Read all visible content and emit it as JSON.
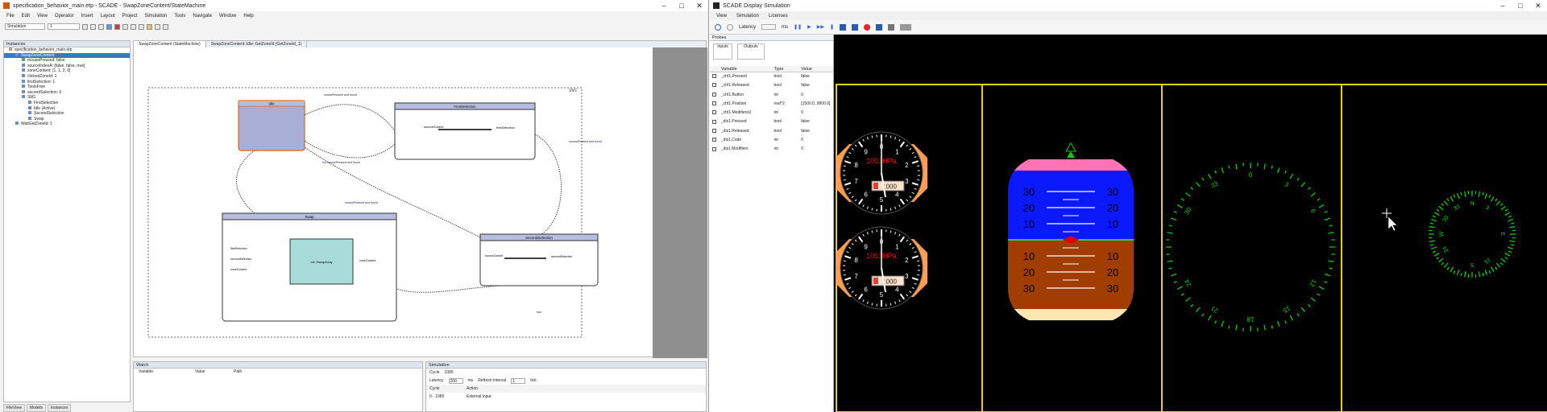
{
  "left_window": {
    "title": "specification_behavior_main.etp - SCADE - SwapZoneContent/StateMachine",
    "menu": [
      "File",
      "Edit",
      "View",
      "Operator",
      "Insert",
      "Layout",
      "Project",
      "Simulation",
      "Tools",
      "Navigate",
      "Window",
      "Help"
    ],
    "toolbar": {
      "config_combo": "Simulation",
      "config_combo2": "1"
    },
    "instances_panel": {
      "title": "Instances",
      "tree": [
        "specification_behavior_main.etp",
        "SwapZoneContent",
        "mousePressed: false",
        "sourceIndexA: [false, false, true]",
        "zoneContent: [1, 1, 2, 0]",
        "clickedZoneId: 1",
        "firstSelection: 1",
        "ToolsFree",
        "secondSelection: 0",
        "SM1",
        "FirstSelection",
        "Idle (Active)",
        "SecondSelection",
        "Swap",
        "WaitGetZoneId: 1"
      ]
    },
    "bottom_tabs": [
      "FileView",
      "Models",
      "Instances"
    ],
    "editor_tabs": [
      "SwapZoneContent (StateMachine)",
      "SwapZoneContent::Idle::GetZoneId (GetZoneId_1)"
    ],
    "diagram": {
      "states": [
        {
          "id": "idle",
          "label": "Idle"
        },
        {
          "id": "first",
          "label": "FirstSelection",
          "in": "sourceZoneId",
          "out": "firstSelection"
        },
        {
          "id": "swap",
          "label": "Swap",
          "inputs": [
            "firstSelection",
            "secondSelection",
            "zoneContent"
          ],
          "op": "Lib::SwapArray",
          "out": "zoneContent"
        },
        {
          "id": "second",
          "label": "SecondSelection",
          "in": "sourceZoneId",
          "out": "secondSelection"
        }
      ],
      "transitions": [
        "mousePressed and found",
        "not mousePressed and found",
        "mousePressed and found",
        "mousePressed and found",
        "true"
      ],
      "frame_label": "SM1"
    },
    "watch_panel": {
      "title": "Watch",
      "columns": [
        "Variable",
        "Value",
        "Path"
      ]
    },
    "simulation_panel": {
      "title": "Simulation",
      "cycle_label": "Cycle",
      "cycle_value": "1085",
      "latency_label": "Latency",
      "latency_value": "200",
      "latency_unit": "ms",
      "refresh_label": "Refresh interval",
      "refresh_value": "1",
      "refresh_unit": "tick",
      "cols": [
        "Cycle",
        "Action"
      ],
      "row": {
        "cycle": "0 - 1085",
        "action": "External input"
      }
    }
  },
  "right_window": {
    "title": "SCADE Display Simulation",
    "menu": [
      "View",
      "Simulation",
      "Licenses"
    ],
    "latency_label": "Latency",
    "latency_value": "",
    "latency_unit": "ms",
    "probes": {
      "title": "Probes",
      "inputs_label": "Inputs",
      "outputs_label": "Outputs",
      "columns": [
        "Variable",
        "Type",
        "Value"
      ],
      "rows": [
        {
          "var": "_ctrl1.Pressed",
          "type": "bool",
          "value": "false"
        },
        {
          "var": "_ctrl1.Released",
          "type": "bool",
          "value": "false"
        },
        {
          "var": "_ctrl1.Button",
          "type": "int",
          "value": "0"
        },
        {
          "var": "_ctrl1.Position",
          "type": "real^2",
          "value": "[1500.0, 9900.0]"
        },
        {
          "var": "_ctrl1.ModifiersU",
          "type": "int",
          "value": "0"
        },
        {
          "var": "_dis1.Pressed",
          "type": "bool",
          "value": "false"
        },
        {
          "var": "_dis1.Released",
          "type": "bool",
          "value": "false"
        },
        {
          "var": "_dis1.Code",
          "type": "int",
          "value": "0"
        },
        {
          "var": "_dis1.Modifiers",
          "type": "int",
          "value": "0"
        }
      ]
    },
    "cockpit": {
      "colors": {
        "frame": "#e8d100",
        "needle": "#ffffff",
        "sky": "#0a19ff",
        "ground": "#a23d00",
        "pink": "#ff72b4",
        "sand": "#ffe7b4",
        "bezel": "#ff9d52",
        "compass": "#00d000"
      },
      "altimeter_labels": [
        "1013HPa",
        "1000"
      ],
      "attitude_scale": [
        "30",
        "20",
        "10",
        "10",
        "20",
        "30"
      ],
      "compass_large": [
        "0",
        "3",
        "33",
        "30",
        "6",
        "12",
        "15",
        "18",
        "21",
        "24"
      ],
      "compass_small": [
        "N",
        "3",
        "33",
        "E",
        "30",
        "W",
        "24",
        "S",
        "15"
      ],
      "altimeter_dial": [
        "0",
        "1",
        "2",
        "3",
        "4",
        "5",
        "6",
        "7",
        "8",
        "9"
      ]
    }
  }
}
